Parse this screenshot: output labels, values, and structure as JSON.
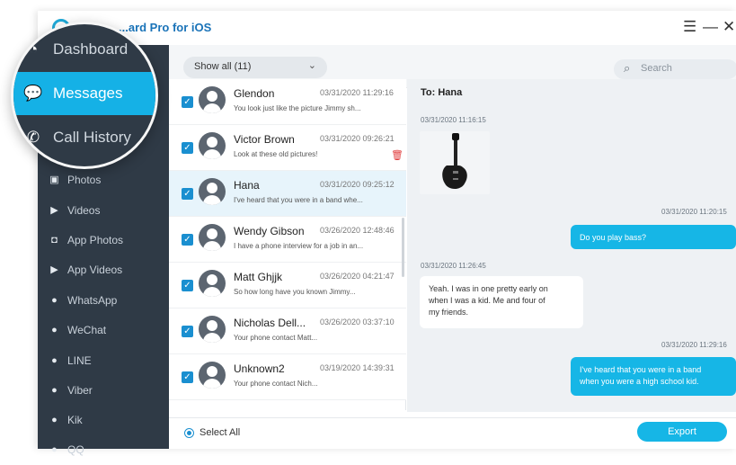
{
  "app": {
    "title": "...ard Pro for iOS"
  },
  "window_controls": {
    "menu": "☰",
    "minimize": "—",
    "close": "✕"
  },
  "sidebar": {
    "items": [
      {
        "label": "Photos",
        "icon": "photos-icon",
        "glyph": "▣"
      },
      {
        "label": "Videos",
        "icon": "videos-icon",
        "glyph": "▶"
      },
      {
        "label": "App Photos",
        "icon": "camera-icon",
        "glyph": "◘"
      },
      {
        "label": "App Videos",
        "icon": "play-icon",
        "glyph": "▶"
      },
      {
        "label": "WhatsApp",
        "icon": "whatsapp-icon",
        "glyph": "●"
      },
      {
        "label": "WeChat",
        "icon": "wechat-icon",
        "glyph": "●"
      },
      {
        "label": "LINE",
        "icon": "line-icon",
        "glyph": "●"
      },
      {
        "label": "Viber",
        "icon": "viber-icon",
        "glyph": "●"
      },
      {
        "label": "Kik",
        "icon": "kik-icon",
        "glyph": "●"
      },
      {
        "label": "QQ",
        "icon": "qq-icon",
        "glyph": "●"
      }
    ]
  },
  "magnifier": {
    "items": [
      {
        "label": "Dashboard",
        "icon": "dashboard-icon",
        "glyph": "◔"
      },
      {
        "label": "Messages",
        "icon": "chat-bubble-icon",
        "glyph": "💬"
      },
      {
        "label": "Call History",
        "icon": "phone-icon",
        "glyph": "✆"
      }
    ]
  },
  "filter": {
    "label": "Show all (11)",
    "chevron": "⌄"
  },
  "search": {
    "placeholder": "Search",
    "glyph": "⌕"
  },
  "conversations": [
    {
      "name": "Glendon",
      "time": "03/31/2020 11:29:16",
      "preview": "You look just like the picture Jimmy sh...",
      "checked": "✓"
    },
    {
      "name": "Victor Brown",
      "time": "03/31/2020 09:26:21",
      "preview": "Look at these old pictures!",
      "checked": "✓"
    },
    {
      "name": "Hana",
      "time": "03/31/2020 09:25:12",
      "preview": "I've heard that you were in a band whe...",
      "checked": "✓"
    },
    {
      "name": "Wendy Gibson",
      "time": "03/26/2020 12:48:46",
      "preview": "I have a phone interview for a job in an...",
      "checked": "✓"
    },
    {
      "name": "Matt Ghjjk",
      "time": "03/26/2020 04:21:47",
      "preview": "So how long have you known Jimmy...",
      "checked": "✓"
    },
    {
      "name": "Nicholas Dell...",
      "time": "03/26/2020 03:37:10",
      "preview": "Your phone contact Matt...",
      "checked": "✓"
    },
    {
      "name": "Unknown2",
      "time": "03/19/2020 14:39:31",
      "preview": "Your phone contact Nich...",
      "checked": "✓"
    }
  ],
  "chat": {
    "to": "To: Hana",
    "messages": [
      {
        "timestamp": "03/31/2020 11:16:15",
        "type": "image",
        "direction": "in"
      },
      {
        "timestamp": "03/31/2020 11:20:15",
        "text": "Do you play bass?",
        "direction": "out"
      },
      {
        "timestamp": "03/31/2020 11:26:45",
        "text_lines": [
          "Yeah. I was in one pretty early on",
          "when I was a kid. Me and four of",
          "my friends."
        ],
        "direction": "in"
      },
      {
        "timestamp": "03/31/2020 11:29:16",
        "text_lines": [
          "I've heard that you were in a band",
          "when you were a high school kid."
        ],
        "direction": "out"
      }
    ]
  },
  "footer": {
    "select_all": "Select All",
    "export": "Export"
  },
  "colors": {
    "accent": "#16b6e6",
    "sidebar": "#2f3a46",
    "delete": "#e03a3a"
  }
}
